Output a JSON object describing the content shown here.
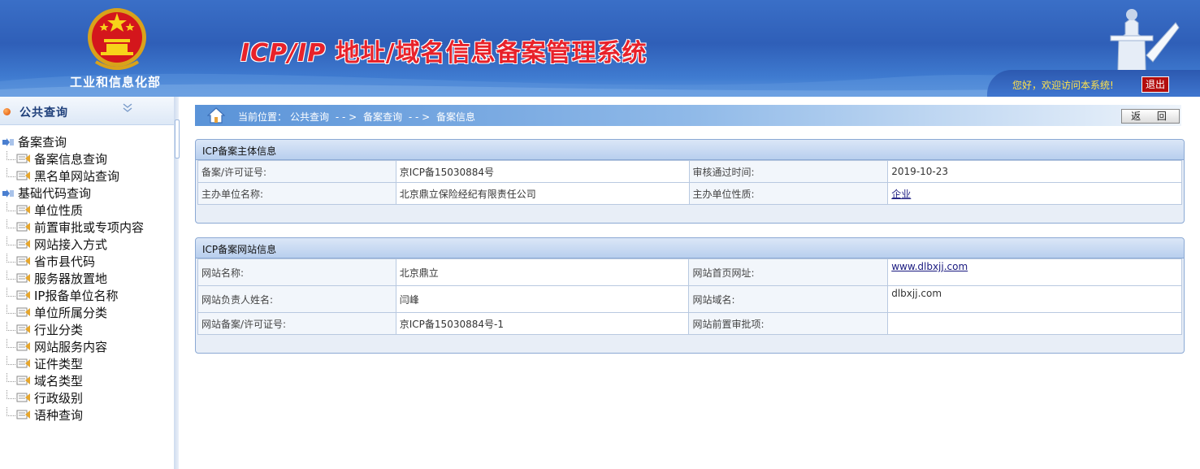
{
  "header": {
    "ministry": "工业和信息化部",
    "title_latin": "ICP/IP",
    "title_cn": " 地址/域名信息备案管理系统",
    "greeting": "您好，欢迎访问本系统!",
    "logout_label": "退出"
  },
  "sidebar": {
    "title": "公共查询",
    "collapse_icon": "double-chevron-down-icon",
    "groups": [
      {
        "label": "备案查询",
        "items": [
          "备案信息查询",
          "黑名单网站查询"
        ]
      },
      {
        "label": "基础代码查询",
        "items": [
          "单位性质",
          "前置审批或专项内容",
          "网站接入方式",
          "省市县代码",
          "服务器放置地",
          "IP报备单位名称",
          "单位所属分类",
          "行业分类",
          "网站服务内容",
          "证件类型",
          "域名类型",
          "行政级别",
          "语种查询"
        ]
      }
    ]
  },
  "breadcrumb": {
    "prefix": "当前位置：",
    "items": [
      "公共查询",
      "- - >",
      "备案查询",
      "- - >",
      "备案信息"
    ]
  },
  "back_label": "返  回",
  "subject_panel": {
    "title": "ICP备案主体信息",
    "rows": [
      {
        "l1": "备案/许可证号:",
        "v1": "京ICP备15030884号",
        "l2": "审核通过时间:",
        "v2": "2019-10-23"
      },
      {
        "l1": "主办单位名称:",
        "v1": "北京鼎立保险经纪有限责任公司",
        "l2": "主办单位性质:",
        "v2": "企业"
      }
    ]
  },
  "site_panel": {
    "title": "ICP备案网站信息",
    "rows": [
      {
        "l1": "网站名称:",
        "v1": "北京鼎立",
        "l2": "网站首页网址:",
        "v2": "www.dlbxjj.com"
      },
      {
        "l1": "网站负责人姓名:",
        "v1": "闫峰",
        "l2": "网站域名:",
        "v2": "dlbxjj.com"
      },
      {
        "l1": "网站备案/许可证号:",
        "v1": "京ICP备15030884号-1",
        "l2": "网站前置审批项:",
        "v2": ""
      }
    ]
  },
  "colors": {
    "header_blue": "#2f5fb8",
    "title_red": "#e8222a",
    "greeting_yellow": "#ffe24a",
    "logout_red": "#b30d0d",
    "panel_border": "#8ba9d4"
  }
}
